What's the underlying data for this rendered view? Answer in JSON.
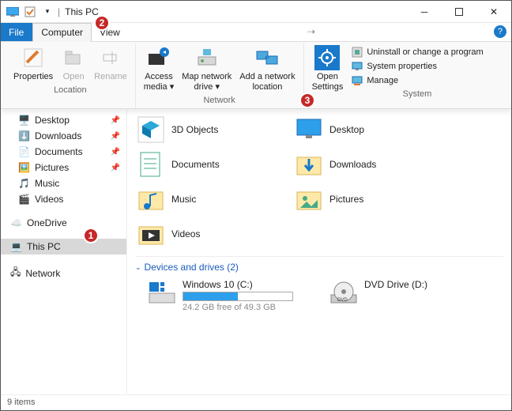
{
  "title": "This PC",
  "tabs": {
    "file": "File",
    "computer": "Computer",
    "view": "View"
  },
  "ribbon": {
    "location": {
      "properties": "Properties",
      "open": "Open",
      "rename": "Rename",
      "group": "Location"
    },
    "network": {
      "access": "Access\nmedia ▾",
      "map": "Map network\ndrive ▾",
      "add": "Add a network\nlocation",
      "group": "Network"
    },
    "system": {
      "open": "Open\nSettings",
      "uninstall": "Uninstall or change a program",
      "props": "System properties",
      "manage": "Manage",
      "group": "System"
    }
  },
  "sidebar": {
    "desktop": "Desktop",
    "downloads": "Downloads",
    "documents": "Documents",
    "pictures": "Pictures",
    "music": "Music",
    "videos": "Videos",
    "onedrive": "OneDrive",
    "thispc": "This PC",
    "network": "Network"
  },
  "folders": {
    "threed": "3D Objects",
    "desktop": "Desktop",
    "documents": "Documents",
    "downloads": "Downloads",
    "music": "Music",
    "pictures": "Pictures",
    "videos": "Videos"
  },
  "devices": {
    "heading": "Devices and drives (2)",
    "cdrive": {
      "name": "Windows 10 (C:)",
      "sub": "24.2 GB free of 49.3 GB",
      "fillPercent": 50
    },
    "dvd": {
      "name": "DVD Drive (D:)"
    }
  },
  "status": "9 items",
  "badges": {
    "one": "1",
    "two": "2",
    "three": "3"
  }
}
